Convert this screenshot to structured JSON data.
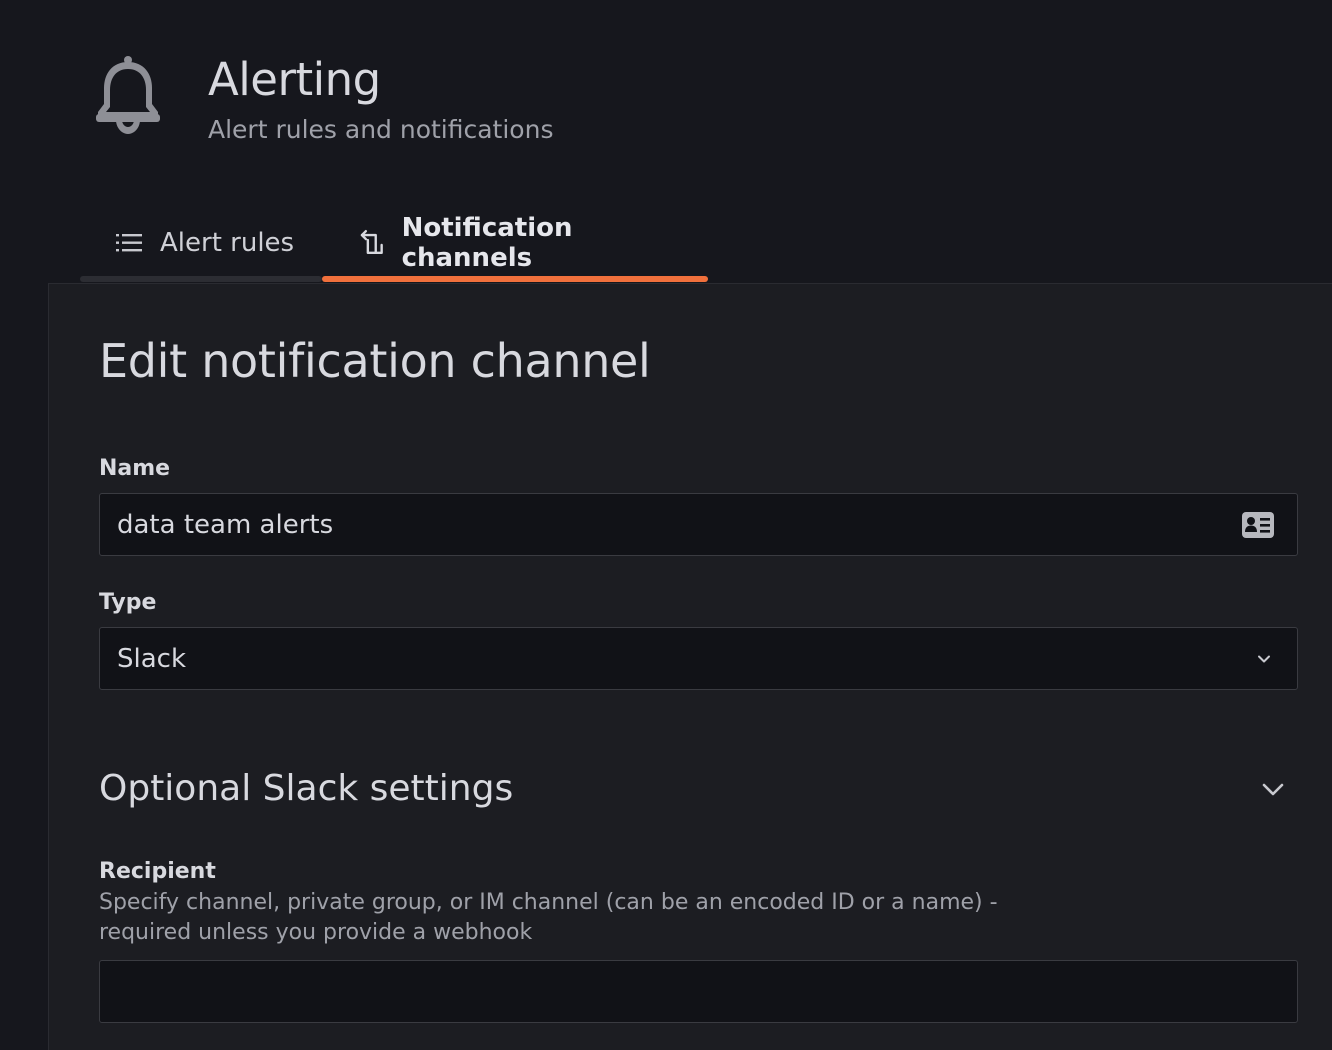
{
  "header": {
    "title": "Alerting",
    "subtitle": "Alert rules and notifications",
    "icon": "bell-icon"
  },
  "tabs": [
    {
      "label": "Alert rules",
      "icon": "list-icon",
      "active": false
    },
    {
      "label": "Notification channels",
      "icon": "channel-icon",
      "active": true
    }
  ],
  "form": {
    "title": "Edit notification channel",
    "name_label": "Name",
    "name_value": "data team alerts",
    "type_label": "Type",
    "type_value": "Slack",
    "section_title": "Optional Slack settings",
    "recipient_label": "Recipient",
    "recipient_description": "Specify channel, private group, or IM channel (can be an encoded ID or a name) - required unless you provide a webhook",
    "recipient_value": ""
  },
  "colors": {
    "accent": "#f0703c",
    "background": "#16171d",
    "panel": "#1c1d22",
    "input": "#111217"
  }
}
